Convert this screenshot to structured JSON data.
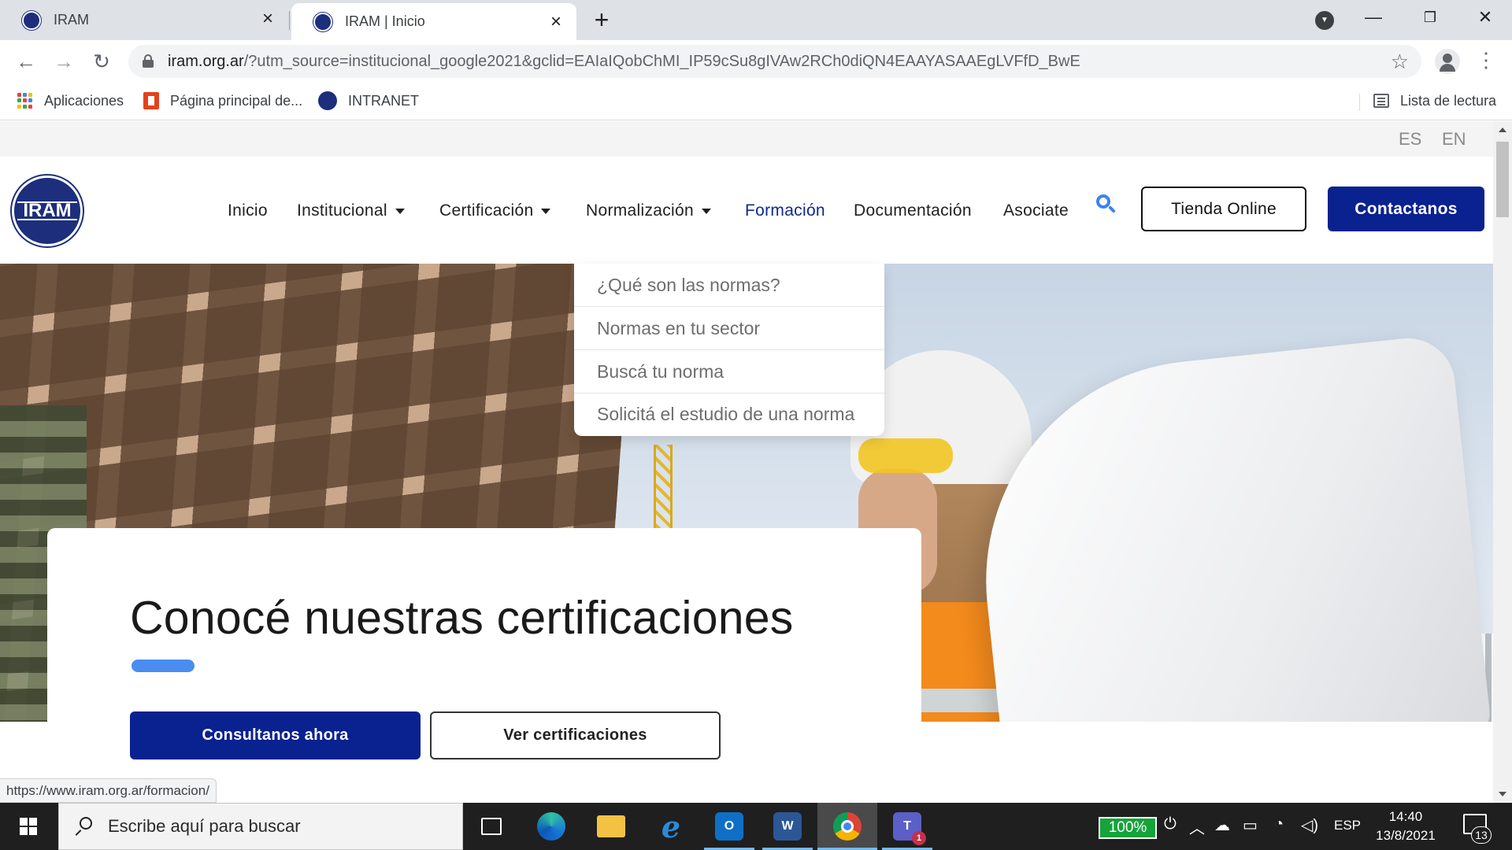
{
  "browser": {
    "tabs": [
      {
        "title": "IRAM"
      },
      {
        "title": "IRAM | Inicio"
      }
    ],
    "address": {
      "domain": "iram.org.ar",
      "path": "/?utm_source=institucional_google2021&gclid=EAIaIQobChMI_IP59cSu8gIVAw2RCh0diQN4EAAYASAAEgLVFfD_BwE"
    },
    "bookmarks": [
      {
        "label": "Aplicaciones"
      },
      {
        "label": "Página principal de..."
      },
      {
        "label": "INTRANET"
      }
    ],
    "reading_list": "Lista de lectura",
    "status_url": "https://www.iram.org.ar/formacion/"
  },
  "site": {
    "languages": [
      "ES",
      "EN"
    ],
    "logo_text": "IRAM",
    "nav": [
      {
        "label": "Inicio",
        "dropdown": false
      },
      {
        "label": "Institucional",
        "dropdown": true
      },
      {
        "label": "Certificación",
        "dropdown": true
      },
      {
        "label": "Normalización",
        "dropdown": true
      },
      {
        "label": "Formación",
        "dropdown": false,
        "active": true
      },
      {
        "label": "Documentación",
        "dropdown": false
      },
      {
        "label": "Asociate",
        "dropdown": false
      }
    ],
    "tienda_label": "Tienda Online",
    "contact_label": "Contactanos",
    "dropdown_items": [
      "¿Qué son las normas?",
      "Normas en tu sector",
      "Buscá tu norma",
      "Solicitá el estudio de una norma"
    ],
    "hero": {
      "title": "Conocé nuestras certificaciones",
      "primary_button": "Consultanos ahora",
      "secondary_button": "Ver certificaciones"
    },
    "colors": {
      "brand_navy": "#0a2190",
      "accent_blue": "#4a8cf0",
      "active_nav": "#0e2a8a"
    }
  },
  "taskbar": {
    "search_placeholder": "Escribe aquí para buscar",
    "apps": [
      "task-view-icon",
      "edge-icon",
      "file-explorer-icon",
      "internet-explorer-icon",
      "outlook-icon",
      "word-icon",
      "chrome-icon",
      "teams-icon"
    ],
    "teams_badge": "1",
    "battery": "100%",
    "language": "ESP",
    "time": "14:40",
    "date": "13/8/2021",
    "notifications": "13"
  }
}
